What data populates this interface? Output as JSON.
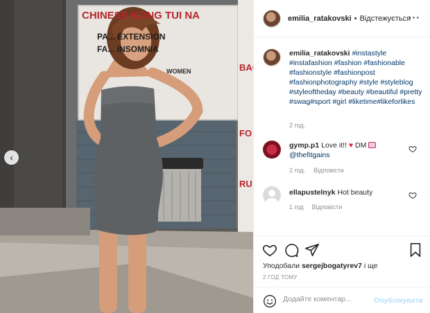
{
  "photo": {
    "sign_line1": "CHINESE KONG TUI NA",
    "sign_line2": "PA... EXTENSION",
    "sign_line3": "FA... INSOMNIA",
    "sign_line4": "WOMEN",
    "sign_right1": "BAC",
    "sign_right2": "FO",
    "sign_right3": "RU",
    "prev_arrow": "‹"
  },
  "header": {
    "username": "emilia_ratakovski",
    "separator": "•",
    "follow_label": "Відстежується",
    "more_label": "···"
  },
  "caption": {
    "username": "emilia_ratakovski",
    "hashtags": "#instastyle #instafashion #fashion #fashionable #fashionstyle #fashionpost #fashionphotography #style #styleblog #styleoftheday #beauty #beautiful #pretty #swag#sport #girl #liketime#likeforlikes",
    "time": "2 год."
  },
  "comments": [
    {
      "username": "gymp.p1",
      "text_before": "Love it!!",
      "text_mid": "DM",
      "text_after": "@thefitgains",
      "time": "2 год.",
      "reply": "Відповісти"
    },
    {
      "username": "ellapustelnyk",
      "text": "Hot beauty",
      "time": "1 год",
      "reply": "Відповісти"
    }
  ],
  "likes": {
    "prefix": "Уподобали",
    "username": "sergejbogatyrev7",
    "suffix": "і ще"
  },
  "post_time": "2 ГОД ТОМУ",
  "comment_input": {
    "placeholder": "Додайте коментар...",
    "publish_label": "Опублікувати"
  },
  "colors": {
    "link": "#00376b",
    "muted": "#8e8e8e",
    "publish_disabled": "#b2dffc",
    "emoji_heart": "#ed1c3c"
  },
  "icons": [
    "chevron-left-icon",
    "more-icon",
    "heart-icon",
    "comment-icon",
    "share-icon",
    "bookmark-icon",
    "smile-icon"
  ]
}
